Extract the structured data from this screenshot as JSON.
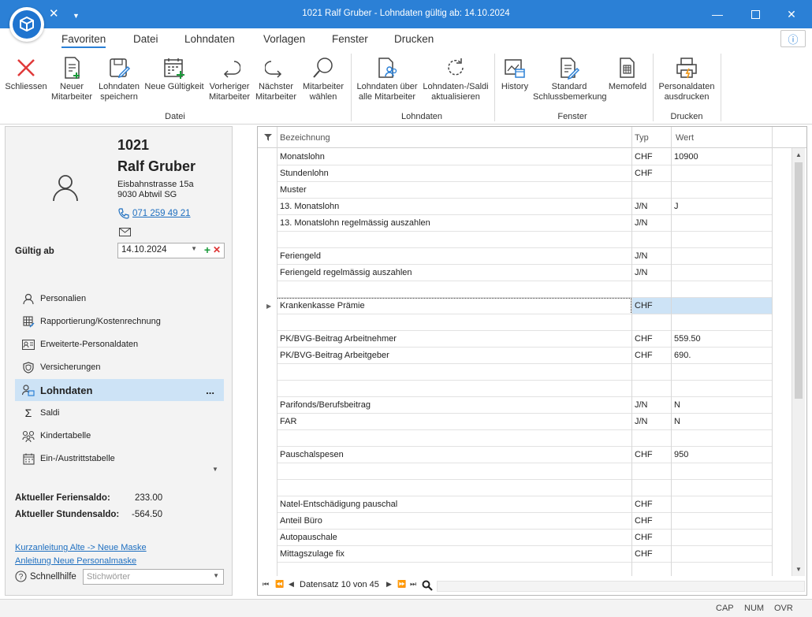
{
  "window": {
    "title": "1021 Ralf Gruber - Lohndaten gültig ab: 14.10.2024"
  },
  "ribbon": {
    "tabs": [
      "Favoriten",
      "Datei",
      "Lohndaten",
      "Vorlagen",
      "Fenster",
      "Drucken"
    ],
    "active_tab": "Favoriten",
    "buttons": {
      "schliessen": "Schliessen",
      "neuer_mitarbeiter": [
        "Neuer",
        "Mitarbeiter"
      ],
      "lohndaten_speichern": [
        "Lohndaten",
        "speichern"
      ],
      "neue_gueltigkeit": "Neue Gültigkeit",
      "vorheriger": [
        "Vorheriger",
        "Mitarbeiter"
      ],
      "naechster": [
        "Nächster",
        "Mitarbeiter"
      ],
      "mitarbeiter_waehlen": [
        "Mitarbeiter",
        "wählen"
      ],
      "lohndaten_alle": [
        "Lohndaten über",
        "alle Mitarbeiter"
      ],
      "saldi_aktualisieren": [
        "Lohndaten-/Saldi",
        "aktualisieren"
      ],
      "history": "History",
      "standard_schluss": [
        "Standard",
        "Schlussbemerkung"
      ],
      "memofeld": "Memofeld",
      "personaldaten_drucken": [
        "Personaldaten",
        "ausdrucken"
      ]
    },
    "groups": {
      "datei": "Datei",
      "lohndaten": "Lohndaten",
      "fenster": "Fenster",
      "drucken": "Drucken"
    }
  },
  "employee": {
    "number": "1021",
    "name": "Ralf Gruber",
    "street": "Eisbahnstrasse 15a",
    "city": "9030 Abtwil SG",
    "phone": "071 259 49 21"
  },
  "gueltig": {
    "label": "Gültig ab",
    "date": "14.10.2024"
  },
  "nav": [
    {
      "label": "Personalien"
    },
    {
      "label": "Rapportierung/Kostenrechnung"
    },
    {
      "label": "Erweiterte-Personaldaten"
    },
    {
      "label": "Versicherungen"
    },
    {
      "label": "Lohndaten",
      "more": "..."
    },
    {
      "label": "Saldi"
    },
    {
      "label": "Kindertabelle"
    },
    {
      "label": "Ein-/Austrittstabelle"
    }
  ],
  "saldi": {
    "ferien_label": "Aktueller Feriensaldo:",
    "ferien_value": "233.00",
    "stunden_label": "Aktueller Stundensaldo:",
    "stunden_value": "-564.50"
  },
  "links": {
    "kurzanleitung": "Kurzanleitung Alte -> Neue Maske",
    "anleitung": "Anleitung Neue Personalmaske"
  },
  "schnellhilfe": {
    "label": "Schnellhilfe",
    "placeholder": "Stichwörter"
  },
  "grid": {
    "columns": [
      "Bezeichnung",
      "Typ",
      "Wert"
    ],
    "rows": [
      {
        "bez": "Monatslohn",
        "typ": "CHF",
        "wert": "10900"
      },
      {
        "bez": "Stundenlohn",
        "typ": "CHF",
        "wert": ""
      },
      {
        "bez": "Muster",
        "typ": "",
        "wert": ""
      },
      {
        "bez": "13. Monatslohn",
        "typ": "J/N",
        "wert": "J"
      },
      {
        "bez": "13. Monatslohn regelmässig auszahlen",
        "typ": "J/N",
        "wert": ""
      },
      {
        "bez": "",
        "typ": "",
        "wert": ""
      },
      {
        "bez": "Feriengeld",
        "typ": "J/N",
        "wert": ""
      },
      {
        "bez": "Feriengeld regelmässig auszahlen",
        "typ": "J/N",
        "wert": ""
      },
      {
        "bez": "",
        "typ": "",
        "wert": ""
      },
      {
        "bez": "Krankenkasse Prämie",
        "typ": "CHF",
        "wert": "",
        "selected": true
      },
      {
        "bez": "",
        "typ": "",
        "wert": ""
      },
      {
        "bez": "PK/BVG-Beitrag Arbeitnehmer",
        "typ": "CHF",
        "wert": "559.50"
      },
      {
        "bez": "PK/BVG-Beitrag Arbeitgeber",
        "typ": "CHF",
        "wert": "690."
      },
      {
        "bez": "",
        "typ": "",
        "wert": ""
      },
      {
        "bez": "",
        "typ": "",
        "wert": ""
      },
      {
        "bez": "Parifonds/Berufsbeitrag",
        "typ": "J/N",
        "wert": "N"
      },
      {
        "bez": "FAR",
        "typ": "J/N",
        "wert": "N"
      },
      {
        "bez": "",
        "typ": "",
        "wert": ""
      },
      {
        "bez": "Pauschalspesen",
        "typ": "CHF",
        "wert": "950"
      },
      {
        "bez": "",
        "typ": "",
        "wert": ""
      },
      {
        "bez": "",
        "typ": "",
        "wert": ""
      },
      {
        "bez": "Natel-Entschädigung pauschal",
        "typ": "CHF",
        "wert": ""
      },
      {
        "bez": "Anteil Büro",
        "typ": "CHF",
        "wert": ""
      },
      {
        "bez": "Autopauschale",
        "typ": "CHF",
        "wert": ""
      },
      {
        "bez": "Mittagszulage fix",
        "typ": "CHF",
        "wert": ""
      }
    ],
    "record_info": "Datensatz 10 von 45"
  },
  "status": [
    "CAP",
    "NUM",
    "OVR"
  ],
  "colors": {
    "titlebar": "#2b80d6",
    "selection": "#cde3f6",
    "link": "#1e6fc0"
  }
}
